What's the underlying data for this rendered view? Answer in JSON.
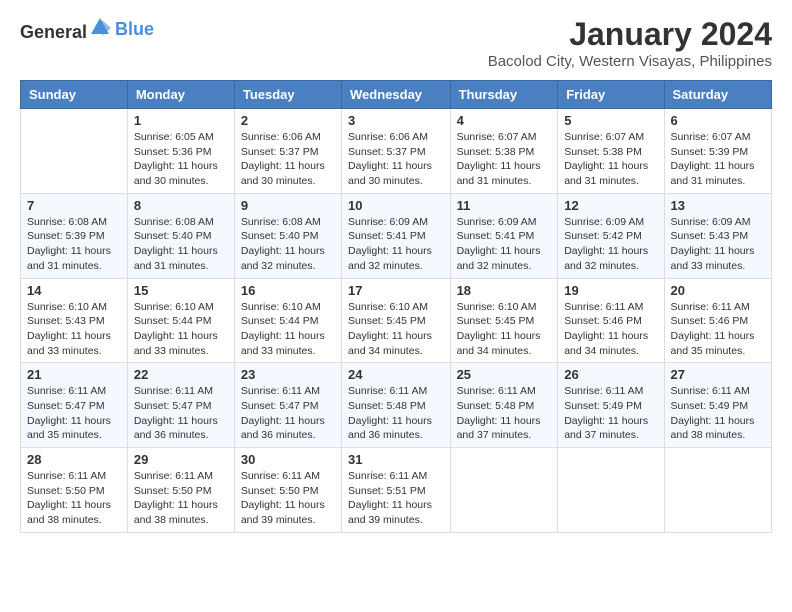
{
  "logo": {
    "text_general": "General",
    "text_blue": "Blue"
  },
  "title": "January 2024",
  "location": "Bacolod City, Western Visayas, Philippines",
  "days_header": [
    "Sunday",
    "Monday",
    "Tuesday",
    "Wednesday",
    "Thursday",
    "Friday",
    "Saturday"
  ],
  "weeks": [
    [
      {
        "day": "",
        "info": ""
      },
      {
        "day": "1",
        "info": "Sunrise: 6:05 AM\nSunset: 5:36 PM\nDaylight: 11 hours and 30 minutes."
      },
      {
        "day": "2",
        "info": "Sunrise: 6:06 AM\nSunset: 5:37 PM\nDaylight: 11 hours and 30 minutes."
      },
      {
        "day": "3",
        "info": "Sunrise: 6:06 AM\nSunset: 5:37 PM\nDaylight: 11 hours and 30 minutes."
      },
      {
        "day": "4",
        "info": "Sunrise: 6:07 AM\nSunset: 5:38 PM\nDaylight: 11 hours and 31 minutes."
      },
      {
        "day": "5",
        "info": "Sunrise: 6:07 AM\nSunset: 5:38 PM\nDaylight: 11 hours and 31 minutes."
      },
      {
        "day": "6",
        "info": "Sunrise: 6:07 AM\nSunset: 5:39 PM\nDaylight: 11 hours and 31 minutes."
      }
    ],
    [
      {
        "day": "7",
        "info": "Sunrise: 6:08 AM\nSunset: 5:39 PM\nDaylight: 11 hours and 31 minutes."
      },
      {
        "day": "8",
        "info": "Sunrise: 6:08 AM\nSunset: 5:40 PM\nDaylight: 11 hours and 31 minutes."
      },
      {
        "day": "9",
        "info": "Sunrise: 6:08 AM\nSunset: 5:40 PM\nDaylight: 11 hours and 32 minutes."
      },
      {
        "day": "10",
        "info": "Sunrise: 6:09 AM\nSunset: 5:41 PM\nDaylight: 11 hours and 32 minutes."
      },
      {
        "day": "11",
        "info": "Sunrise: 6:09 AM\nSunset: 5:41 PM\nDaylight: 11 hours and 32 minutes."
      },
      {
        "day": "12",
        "info": "Sunrise: 6:09 AM\nSunset: 5:42 PM\nDaylight: 11 hours and 32 minutes."
      },
      {
        "day": "13",
        "info": "Sunrise: 6:09 AM\nSunset: 5:43 PM\nDaylight: 11 hours and 33 minutes."
      }
    ],
    [
      {
        "day": "14",
        "info": "Sunrise: 6:10 AM\nSunset: 5:43 PM\nDaylight: 11 hours and 33 minutes."
      },
      {
        "day": "15",
        "info": "Sunrise: 6:10 AM\nSunset: 5:44 PM\nDaylight: 11 hours and 33 minutes."
      },
      {
        "day": "16",
        "info": "Sunrise: 6:10 AM\nSunset: 5:44 PM\nDaylight: 11 hours and 33 minutes."
      },
      {
        "day": "17",
        "info": "Sunrise: 6:10 AM\nSunset: 5:45 PM\nDaylight: 11 hours and 34 minutes."
      },
      {
        "day": "18",
        "info": "Sunrise: 6:10 AM\nSunset: 5:45 PM\nDaylight: 11 hours and 34 minutes."
      },
      {
        "day": "19",
        "info": "Sunrise: 6:11 AM\nSunset: 5:46 PM\nDaylight: 11 hours and 34 minutes."
      },
      {
        "day": "20",
        "info": "Sunrise: 6:11 AM\nSunset: 5:46 PM\nDaylight: 11 hours and 35 minutes."
      }
    ],
    [
      {
        "day": "21",
        "info": "Sunrise: 6:11 AM\nSunset: 5:47 PM\nDaylight: 11 hours and 35 minutes."
      },
      {
        "day": "22",
        "info": "Sunrise: 6:11 AM\nSunset: 5:47 PM\nDaylight: 11 hours and 36 minutes."
      },
      {
        "day": "23",
        "info": "Sunrise: 6:11 AM\nSunset: 5:47 PM\nDaylight: 11 hours and 36 minutes."
      },
      {
        "day": "24",
        "info": "Sunrise: 6:11 AM\nSunset: 5:48 PM\nDaylight: 11 hours and 36 minutes."
      },
      {
        "day": "25",
        "info": "Sunrise: 6:11 AM\nSunset: 5:48 PM\nDaylight: 11 hours and 37 minutes."
      },
      {
        "day": "26",
        "info": "Sunrise: 6:11 AM\nSunset: 5:49 PM\nDaylight: 11 hours and 37 minutes."
      },
      {
        "day": "27",
        "info": "Sunrise: 6:11 AM\nSunset: 5:49 PM\nDaylight: 11 hours and 38 minutes."
      }
    ],
    [
      {
        "day": "28",
        "info": "Sunrise: 6:11 AM\nSunset: 5:50 PM\nDaylight: 11 hours and 38 minutes."
      },
      {
        "day": "29",
        "info": "Sunrise: 6:11 AM\nSunset: 5:50 PM\nDaylight: 11 hours and 38 minutes."
      },
      {
        "day": "30",
        "info": "Sunrise: 6:11 AM\nSunset: 5:50 PM\nDaylight: 11 hours and 39 minutes."
      },
      {
        "day": "31",
        "info": "Sunrise: 6:11 AM\nSunset: 5:51 PM\nDaylight: 11 hours and 39 minutes."
      },
      {
        "day": "",
        "info": ""
      },
      {
        "day": "",
        "info": ""
      },
      {
        "day": "",
        "info": ""
      }
    ]
  ]
}
